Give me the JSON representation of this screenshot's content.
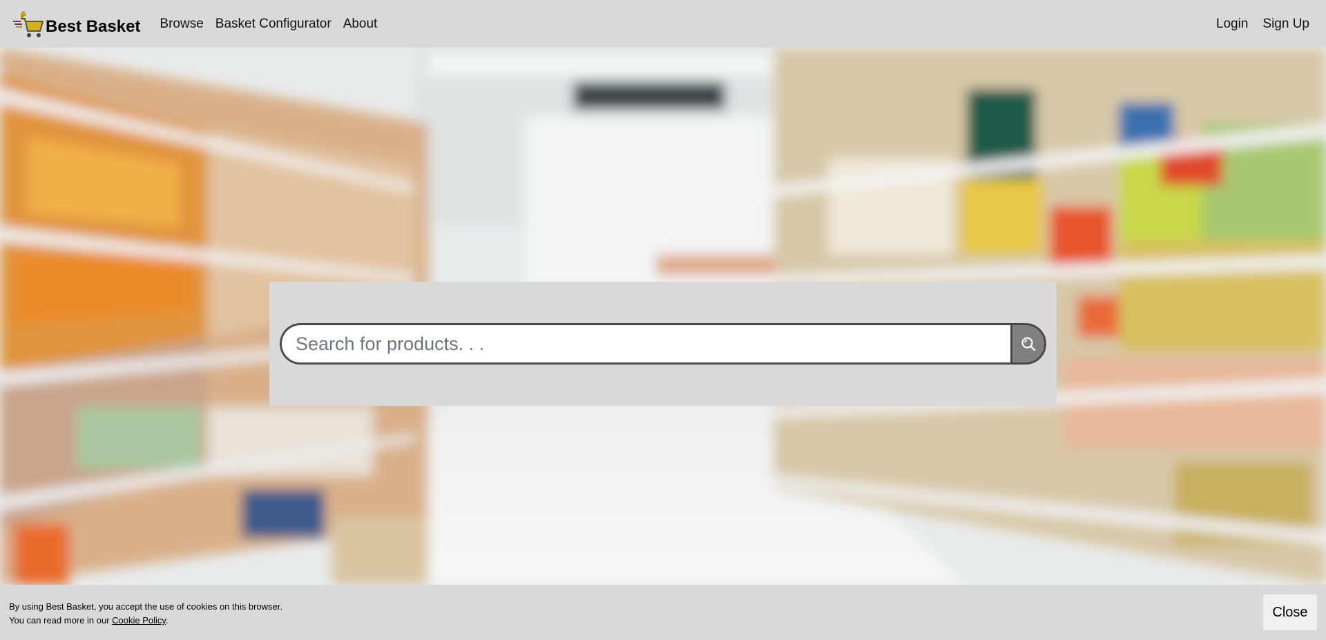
{
  "header": {
    "brand": "Best Basket",
    "nav": [
      "Browse",
      "Basket Configurator",
      "About"
    ],
    "login": "Login",
    "signup": "Sign Up"
  },
  "search": {
    "placeholder": "Search for products. . ."
  },
  "cookie": {
    "line1": "By using Best Basket, you accept the use of cookies on this browser.",
    "line2_prefix": "You can read more in our ",
    "link": "Cookie Policy",
    "line2_suffix": ".",
    "close": "Close"
  },
  "colors": {
    "bar_bg": "#d9d9d9",
    "search_border": "#4a4a4a",
    "search_button": "#808080"
  }
}
